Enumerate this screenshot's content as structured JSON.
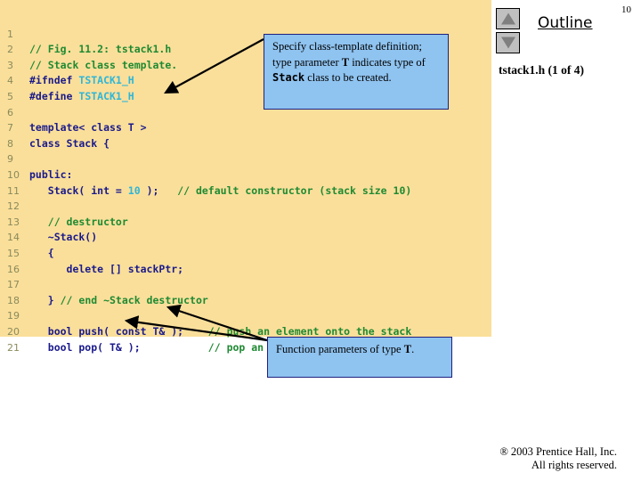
{
  "page": {
    "number": "10",
    "background_color": "#ffffff"
  },
  "code_panel": {
    "background_color": "#fadf9a",
    "comment_color": "#1f8a32",
    "keyword_color": "#1a1a8c",
    "literal_color": "#2fb6d8",
    "line_number_color": "#8a8a5c",
    "lines": [
      {
        "n": "1",
        "text": "// Fig. 11.2: tstack1.h"
      },
      {
        "n": "2",
        "text": "// Stack class template."
      },
      {
        "n": "3",
        "text": "#ifndef TSTACK1_H"
      },
      {
        "n": "4",
        "text": "#define TSTACK1_H"
      },
      {
        "n": "5",
        "text": ""
      },
      {
        "n": "6",
        "text": "template< class T >"
      },
      {
        "n": "7",
        "text": "class Stack {"
      },
      {
        "n": "8",
        "text": ""
      },
      {
        "n": "9",
        "text": "public:"
      },
      {
        "n": "10",
        "text": "   Stack( int = 10 );   // default constructor (stack size 10)"
      },
      {
        "n": "11",
        "text": ""
      },
      {
        "n": "12",
        "text": "   // destructor"
      },
      {
        "n": "13",
        "text": "   ~Stack()"
      },
      {
        "n": "14",
        "text": "   {"
      },
      {
        "n": "15",
        "text": "      delete [] stackPtr;"
      },
      {
        "n": "16",
        "text": ""
      },
      {
        "n": "17",
        "text": "   } // end ~Stack destructor"
      },
      {
        "n": "18",
        "text": ""
      },
      {
        "n": "19",
        "text": "   bool push( const T& );    // push an element onto the stack"
      },
      {
        "n": "20",
        "text": "   bool pop( T& );           // pop an element off the stack"
      },
      {
        "n": "21",
        "text": ""
      }
    ]
  },
  "callouts": [
    {
      "id": "callout-1",
      "text": "Specify class-template definition; type parameter T indicates type of Stack class to be created.",
      "background_color": "#8fc3f0",
      "border_color": "#202080"
    },
    {
      "id": "callout-2",
      "text": "Function parameters of type T.",
      "background_color": "#8fc3f0",
      "border_color": "#202080"
    }
  ],
  "outline": {
    "title": "Outline",
    "file_label": "tstack1.h (1 of 4)",
    "nav_up_icon": "triangle-up-icon",
    "nav_down_icon": "triangle-down-icon"
  },
  "footer": {
    "line1": "® 2003 Prentice Hall, Inc.",
    "line2": "All rights reserved."
  }
}
